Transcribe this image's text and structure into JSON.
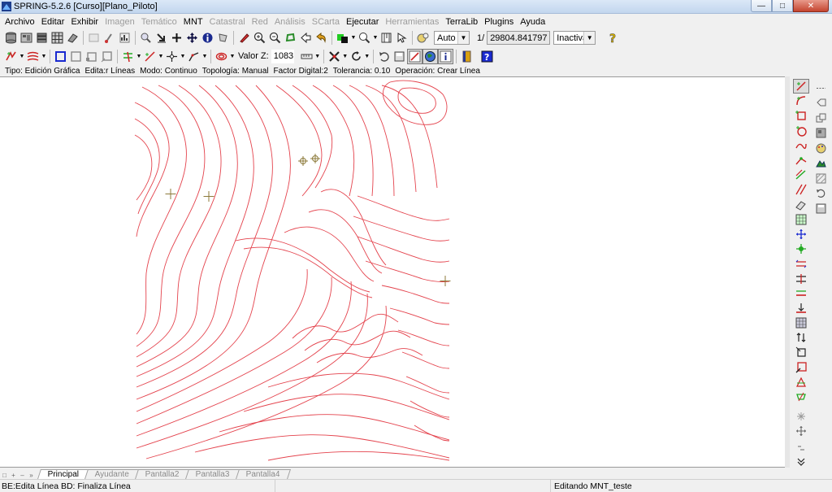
{
  "window": {
    "title": "SPRING-5.2.6 [Curso][Plano_Piloto]"
  },
  "menu": [
    {
      "label": "Archivo",
      "enabled": true
    },
    {
      "label": "Editar",
      "enabled": true
    },
    {
      "label": "Exhibir",
      "enabled": true
    },
    {
      "label": "Imagen",
      "enabled": false
    },
    {
      "label": "Temático",
      "enabled": false
    },
    {
      "label": "MNT",
      "enabled": true
    },
    {
      "label": "Catastral",
      "enabled": false
    },
    {
      "label": "Red",
      "enabled": false
    },
    {
      "label": "Análisis",
      "enabled": false
    },
    {
      "label": "SCarta",
      "enabled": false
    },
    {
      "label": "Ejecutar",
      "enabled": true
    },
    {
      "label": "Herramientas",
      "enabled": false
    },
    {
      "label": "TerraLib",
      "enabled": true
    },
    {
      "label": "Plugins",
      "enabled": true
    },
    {
      "label": "Ayuda",
      "enabled": true
    }
  ],
  "toolbar": {
    "zoom_mode": "Auto",
    "scale_prefix": "1/",
    "scale_value": "29804.841797",
    "state_value": "Inactiva",
    "valor_z_label": "Valor Z:",
    "valor_z_value": "1083"
  },
  "info_bar": {
    "tipo": "Tipo: Edición Gráfica",
    "edita": "Edita:r Líneas",
    "modo": "Modo: Continuo",
    "topologia": "Topología: Manual",
    "factor": "Factor Digital:2",
    "tolerancia": "Tolerancia: 0.10",
    "operacion": "Operación: Crear Línea"
  },
  "tabs": [
    "Principal",
    "Ayudante",
    "Pantalla2",
    "Pantalla3",
    "Pantalla4"
  ],
  "active_tab": "Principal",
  "status": {
    "left": "BE:Edita Línea  BD: Finaliza Línea",
    "right": "Editando MNT_teste"
  },
  "colors": {
    "contour": "#e4434d",
    "marker": "#8c7a3a"
  }
}
